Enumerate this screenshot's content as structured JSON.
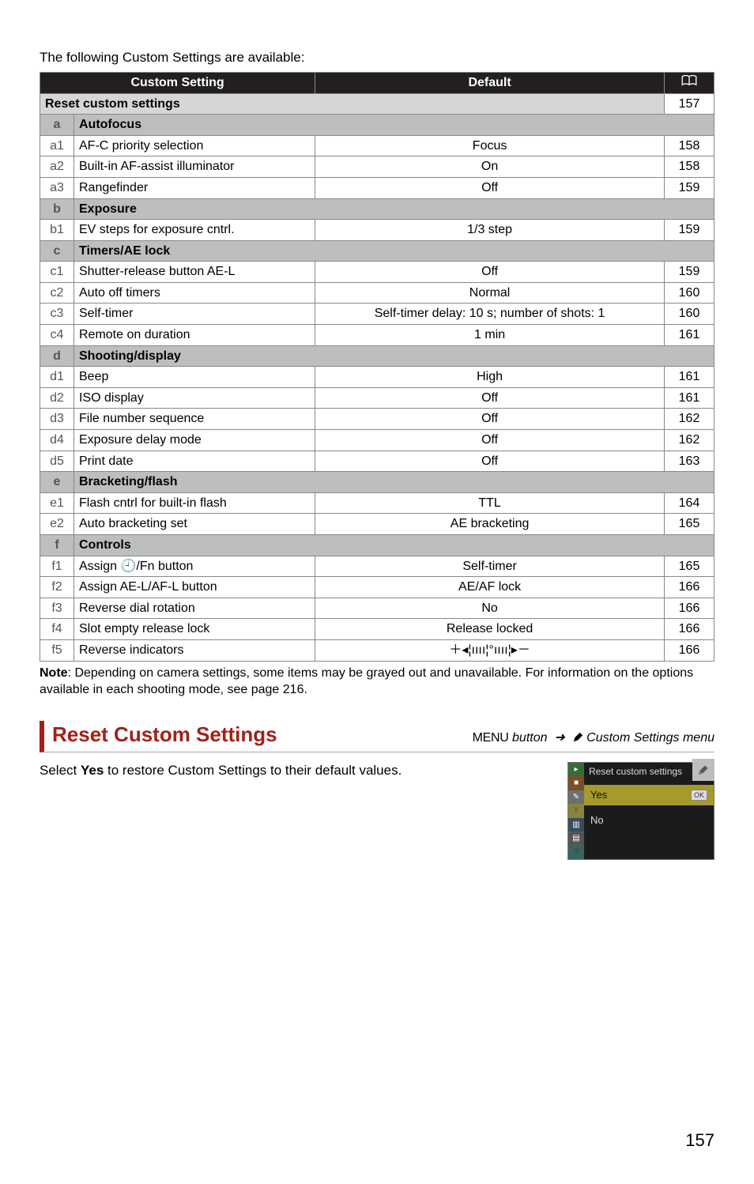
{
  "intro": "The following Custom Settings are available:",
  "headers": {
    "setting": "Custom Setting",
    "default": "Default"
  },
  "reset_row": {
    "label": "Reset custom settings",
    "page": "157"
  },
  "sections": [
    {
      "key": "a",
      "label": "Autofocus",
      "items": [
        {
          "key": "a1",
          "name": "AF-C priority selection",
          "default": "Focus",
          "page": "158"
        },
        {
          "key": "a2",
          "name": "Built-in AF-assist illuminator",
          "default": "On",
          "page": "158"
        },
        {
          "key": "a3",
          "name": "Rangefinder",
          "default": "Off",
          "page": "159"
        }
      ]
    },
    {
      "key": "b",
      "label": "Exposure",
      "items": [
        {
          "key": "b1",
          "name": "EV steps for exposure cntrl.",
          "default": "1/3 step",
          "page": "159"
        }
      ]
    },
    {
      "key": "c",
      "label": "Timers/AE lock",
      "items": [
        {
          "key": "c1",
          "name": "Shutter-release button AE-L",
          "default": "Off",
          "page": "159"
        },
        {
          "key": "c2",
          "name": "Auto off timers",
          "default": "Normal",
          "page": "160"
        },
        {
          "key": "c3",
          "name": "Self-timer",
          "default": "Self-timer delay: 10 s; number of shots: 1",
          "page": "160"
        },
        {
          "key": "c4",
          "name": "Remote on duration",
          "default": "1 min",
          "page": "161"
        }
      ]
    },
    {
      "key": "d",
      "label": "Shooting/display",
      "items": [
        {
          "key": "d1",
          "name": "Beep",
          "default": "High",
          "page": "161"
        },
        {
          "key": "d2",
          "name": "ISO display",
          "default": "Off",
          "page": "161"
        },
        {
          "key": "d3",
          "name": "File number sequence",
          "default": "Off",
          "page": "162"
        },
        {
          "key": "d4",
          "name": "Exposure delay mode",
          "default": "Off",
          "page": "162"
        },
        {
          "key": "d5",
          "name": "Print date",
          "default": "Off",
          "page": "163"
        }
      ]
    },
    {
      "key": "e",
      "label": "Bracketing/flash",
      "items": [
        {
          "key": "e1",
          "name": "Flash cntrl for built-in flash",
          "default": "TTL",
          "page": "164"
        },
        {
          "key": "e2",
          "name": "Auto bracketing set",
          "default": "AE bracketing",
          "page": "165"
        }
      ]
    },
    {
      "key": "f",
      "label": "Controls",
      "items": [
        {
          "key": "f1",
          "name": "Assign 🕘/Fn button",
          "default": "Self-timer",
          "page": "165"
        },
        {
          "key": "f2",
          "name": "Assign AE-L/AF-L button",
          "default": "AE/AF lock",
          "page": "166"
        },
        {
          "key": "f3",
          "name": "Reverse dial rotation",
          "default": "No",
          "page": "166"
        },
        {
          "key": "f4",
          "name": "Slot empty release lock",
          "default": "Release locked",
          "page": "166"
        },
        {
          "key": "f5",
          "name": "Reverse indicators",
          "default": "＋◂¦ıııı¦°ıııı¦▸－",
          "page": "166"
        }
      ]
    }
  ],
  "note_label": "Note",
  "note_text": ": Depending on camera settings, some items may be grayed out and unavailable.  For information on the options available in each shooting mode, see page 216.",
  "heading": {
    "title": "Reset Custom Settings",
    "menu_kw": "MENU",
    "path_button": " button",
    "arrow": "➜",
    "path_tail": " Custom Settings menu"
  },
  "select_text_1": "Select ",
  "select_text_bold": "Yes",
  "select_text_2": " to restore Custom Settings to their default values.",
  "screenshot": {
    "title": "Reset custom settings",
    "yes": "Yes",
    "no": "No",
    "ok": "OK"
  },
  "page_number": "157"
}
